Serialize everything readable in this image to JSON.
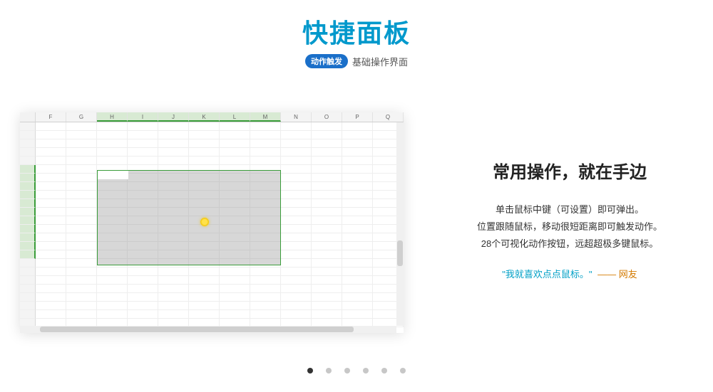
{
  "header": {
    "title": "快捷面板",
    "badge": "动作触发",
    "subtitle": "基础操作界面"
  },
  "spreadsheet": {
    "columns": [
      "F",
      "G",
      "H",
      "I",
      "J",
      "K",
      "L",
      "M",
      "N",
      "O",
      "P",
      "Q"
    ],
    "selected_cols": [
      "H",
      "I",
      "J",
      "K",
      "L",
      "M"
    ],
    "row_count": 24,
    "selected_rows_start": 6,
    "selected_rows_end": 16
  },
  "feature": {
    "heading": "常用操作，就在手边",
    "line1": "单击鼠标中键（可设置）即可弹出。",
    "line2": "位置跟随鼠标，移动很短距离即可触发动作。",
    "line3": "28个可视化动作按钮，远超超极多键鼠标。",
    "quote": "\"我就喜欢点点鼠标。\"",
    "quote_attr": "—— 网友"
  },
  "carousel": {
    "total": 6,
    "active_index": 0
  }
}
